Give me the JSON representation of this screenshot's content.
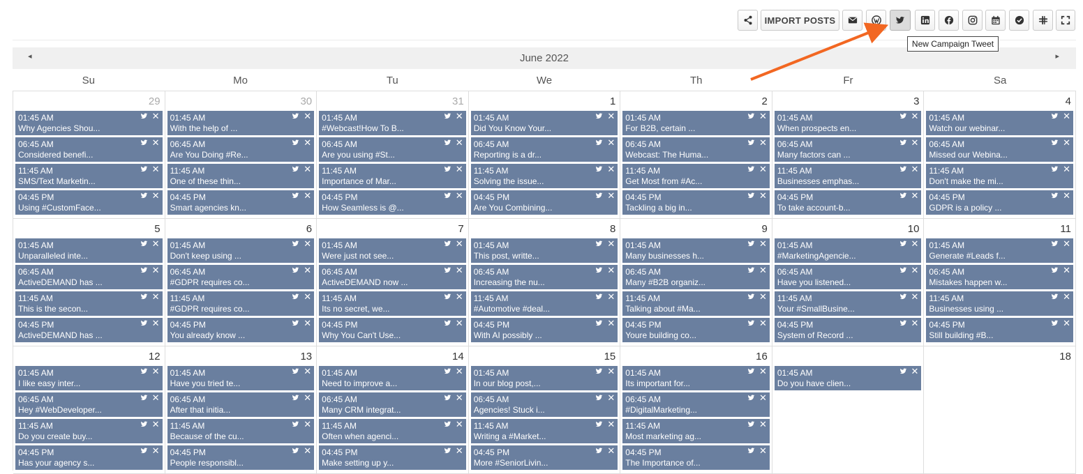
{
  "toolbar": {
    "import_label": "IMPORT POSTS",
    "tooltip": "New Campaign Tweet",
    "buttons": [
      "share-icon",
      "import-posts",
      "email-icon",
      "wordpress-icon",
      "twitter-icon",
      "linkedin-icon",
      "facebook-icon",
      "instagram-icon",
      "calendar-icon",
      "check-circle-icon",
      "slack-icon",
      "fullscreen-icon"
    ],
    "active_button": "twitter-icon"
  },
  "calendar": {
    "title": "June 2022",
    "prev_label": "◂",
    "next_label": "▸",
    "days_of_week": [
      "Su",
      "Mo",
      "Tu",
      "We",
      "Th",
      "Fr",
      "Sa"
    ],
    "event_color": "#6a7f9f",
    "weeks": [
      [
        {
          "day": "29",
          "other": true,
          "events": [
            {
              "time": "01:45 AM",
              "text": "Why Agencies Shou..."
            },
            {
              "time": "06:45 AM",
              "text": "Considered benefi..."
            },
            {
              "time": "11:45 AM",
              "text": "SMS/Text Marketin..."
            },
            {
              "time": "04:45 PM",
              "text": "Using #CustomFace..."
            }
          ]
        },
        {
          "day": "30",
          "other": true,
          "events": [
            {
              "time": "01:45 AM",
              "text": "With the help of ..."
            },
            {
              "time": "06:45 AM",
              "text": "Are You Doing #Re..."
            },
            {
              "time": "11:45 AM",
              "text": "One of these thin..."
            },
            {
              "time": "04:45 PM",
              "text": "Smart agencies kn..."
            }
          ]
        },
        {
          "day": "31",
          "other": true,
          "events": [
            {
              "time": "01:45 AM",
              "text": "#Webcast!How To B..."
            },
            {
              "time": "06:45 AM",
              "text": "Are you using #St..."
            },
            {
              "time": "11:45 AM",
              "text": "Importance of Mar..."
            },
            {
              "time": "04:45 PM",
              "text": "How Seamless is @..."
            }
          ]
        },
        {
          "day": "1",
          "events": [
            {
              "time": "01:45 AM",
              "text": "Did You Know Your..."
            },
            {
              "time": "06:45 AM",
              "text": "Reporting is a dr..."
            },
            {
              "time": "11:45 AM",
              "text": "Solving the issue..."
            },
            {
              "time": "04:45 PM",
              "text": "Are You Combining..."
            }
          ]
        },
        {
          "day": "2",
          "events": [
            {
              "time": "01:45 AM",
              "text": "For B2B, certain ..."
            },
            {
              "time": "06:45 AM",
              "text": "Webcast: The Huma..."
            },
            {
              "time": "11:45 AM",
              "text": "Get Most from #Ac..."
            },
            {
              "time": "04:45 PM",
              "text": "Tackling a big in..."
            }
          ]
        },
        {
          "day": "3",
          "events": [
            {
              "time": "01:45 AM",
              "text": "When prospects en..."
            },
            {
              "time": "06:45 AM",
              "text": "Many factors can ..."
            },
            {
              "time": "11:45 AM",
              "text": "Businesses emphas..."
            },
            {
              "time": "04:45 PM",
              "text": "To take account-b..."
            }
          ]
        },
        {
          "day": "4",
          "events": [
            {
              "time": "01:45 AM",
              "text": "Watch our webinar..."
            },
            {
              "time": "06:45 AM",
              "text": "Missed our Webina..."
            },
            {
              "time": "11:45 AM",
              "text": "Don't make the mi..."
            },
            {
              "time": "04:45 PM",
              "text": "GDPR is a policy ..."
            }
          ]
        }
      ],
      [
        {
          "day": "5",
          "events": [
            {
              "time": "01:45 AM",
              "text": "Unparalleled inte..."
            },
            {
              "time": "06:45 AM",
              "text": "ActiveDEMAND has ..."
            },
            {
              "time": "11:45 AM",
              "text": "This is the secon..."
            },
            {
              "time": "04:45 PM",
              "text": "ActiveDEMAND has ..."
            }
          ]
        },
        {
          "day": "6",
          "events": [
            {
              "time": "01:45 AM",
              "text": "Don't keep using ..."
            },
            {
              "time": "06:45 AM",
              "text": "#GDPR requires co..."
            },
            {
              "time": "11:45 AM",
              "text": "#GDPR requires co..."
            },
            {
              "time": "04:45 PM",
              "text": "You already know ..."
            }
          ]
        },
        {
          "day": "7",
          "events": [
            {
              "time": "01:45 AM",
              "text": "Were just not see..."
            },
            {
              "time": "06:45 AM",
              "text": "ActiveDEMAND now ..."
            },
            {
              "time": "11:45 AM",
              "text": "Its no secret, we..."
            },
            {
              "time": "04:45 PM",
              "text": "Why You Can't Use..."
            }
          ]
        },
        {
          "day": "8",
          "events": [
            {
              "time": "01:45 AM",
              "text": "This post, writte..."
            },
            {
              "time": "06:45 AM",
              "text": "Increasing the nu..."
            },
            {
              "time": "11:45 AM",
              "text": "#Automotive #deal..."
            },
            {
              "time": "04:45 PM",
              "text": "With AI possibly ..."
            }
          ]
        },
        {
          "day": "9",
          "events": [
            {
              "time": "01:45 AM",
              "text": "Many businesses h..."
            },
            {
              "time": "06:45 AM",
              "text": "Many #B2B organiz..."
            },
            {
              "time": "11:45 AM",
              "text": "Talking about #Ma..."
            },
            {
              "time": "04:45 PM",
              "text": "Youre building co..."
            }
          ]
        },
        {
          "day": "10",
          "events": [
            {
              "time": "01:45 AM",
              "text": "#MarketingAgencie..."
            },
            {
              "time": "06:45 AM",
              "text": "Have you listened..."
            },
            {
              "time": "11:45 AM",
              "text": "Your #SmallBusine..."
            },
            {
              "time": "04:45 PM",
              "text": "System of Record ..."
            }
          ]
        },
        {
          "day": "11",
          "events": [
            {
              "time": "01:45 AM",
              "text": "Generate #Leads f..."
            },
            {
              "time": "06:45 AM",
              "text": "Mistakes happen w..."
            },
            {
              "time": "11:45 AM",
              "text": "Businesses using ..."
            },
            {
              "time": "04:45 PM",
              "text": "Still building #B..."
            }
          ]
        }
      ],
      [
        {
          "day": "12",
          "events": [
            {
              "time": "01:45 AM",
              "text": "I like easy inter..."
            },
            {
              "time": "06:45 AM",
              "text": "Hey #WebDeveloper..."
            },
            {
              "time": "11:45 AM",
              "text": "Do you create buy..."
            },
            {
              "time": "04:45 PM",
              "text": "Has your agency s..."
            }
          ]
        },
        {
          "day": "13",
          "events": [
            {
              "time": "01:45 AM",
              "text": "Have you tried te..."
            },
            {
              "time": "06:45 AM",
              "text": "After that initia..."
            },
            {
              "time": "11:45 AM",
              "text": "Because of the cu..."
            },
            {
              "time": "04:45 PM",
              "text": "People responsibl..."
            }
          ]
        },
        {
          "day": "14",
          "events": [
            {
              "time": "01:45 AM",
              "text": "Need to improve a..."
            },
            {
              "time": "06:45 AM",
              "text": "Many CRM integrat..."
            },
            {
              "time": "11:45 AM",
              "text": "Often when agenci..."
            },
            {
              "time": "04:45 PM",
              "text": "Make setting up y..."
            }
          ]
        },
        {
          "day": "15",
          "events": [
            {
              "time": "01:45 AM",
              "text": "In our blog post,..."
            },
            {
              "time": "06:45 AM",
              "text": "Agencies! Stuck i..."
            },
            {
              "time": "11:45 AM",
              "text": "Writing a #Market..."
            },
            {
              "time": "04:45 PM",
              "text": "More #SeniorLivin..."
            }
          ]
        },
        {
          "day": "16",
          "events": [
            {
              "time": "01:45 AM",
              "text": "Its important for..."
            },
            {
              "time": "06:45 AM",
              "text": "#DigitalMarketing..."
            },
            {
              "time": "11:45 AM",
              "text": "Most marketing ag..."
            },
            {
              "time": "04:45 PM",
              "text": "The Importance of..."
            }
          ]
        },
        {
          "day": "",
          "events": [
            {
              "time": "01:45 AM",
              "text": "Do you have clien..."
            }
          ]
        },
        {
          "day": "18",
          "events": []
        }
      ]
    ]
  }
}
